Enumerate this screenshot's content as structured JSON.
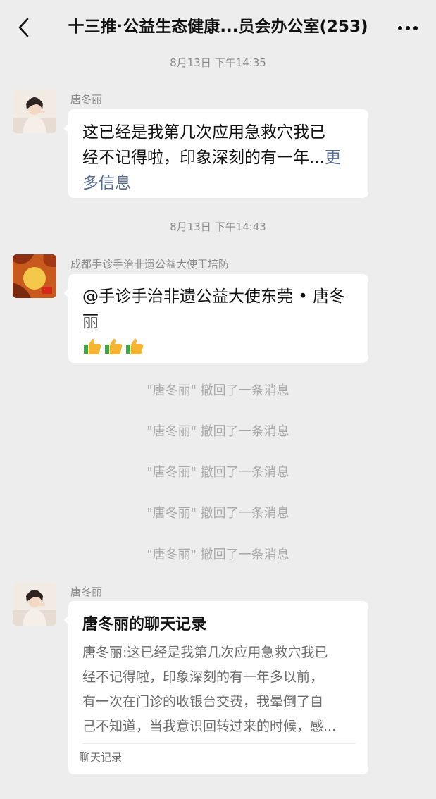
{
  "header": {
    "title": "十三推·公益生态健康...员会办公室(253)",
    "back_icon": "chevron-left-icon",
    "more_icon": "more-dots-icon"
  },
  "messages": {
    "time1": "8月13日 下午14:35",
    "msg1": {
      "sender": "唐冬丽",
      "text_line1": "这已经是我第几次应用急救穴我已",
      "text_line2a": "经不记得啦，印象深刻的有一年...",
      "more_a": "更",
      "more_b": "多信息"
    },
    "time2": "8月13日 下午14:43",
    "msg2": {
      "sender": "成都手诊手治非遗公益大使王培防",
      "text_line1": "@手诊手治非遗公益大使东莞 • 唐冬",
      "text_line2": "丽",
      "emoji": "thumbs-up-icon"
    },
    "recalls": [
      "\"唐冬丽\" 撤回了一条消息",
      "\"唐冬丽\" 撤回了一条消息",
      "\"唐冬丽\" 撤回了一条消息",
      "\"唐冬丽\" 撤回了一条消息",
      "\"唐冬丽\" 撤回了一条消息"
    ],
    "msg3": {
      "sender": "唐冬丽",
      "card_title": "唐冬丽的聊天记录",
      "card_lines": [
        "唐冬丽:这已经是我第几次应用急救穴我已",
        "经不记得啦，印象深刻的有一年多以前，",
        "有一次在门诊的收银台交费，我晕倒了自",
        "己不知道，当我意识回转过来的时候，感..."
      ],
      "card_footer": "聊天记录"
    }
  },
  "colors": {
    "background": "#ededed",
    "bubble": "#ffffff",
    "link": "#576b95",
    "meta_text": "#8a8a8a"
  }
}
